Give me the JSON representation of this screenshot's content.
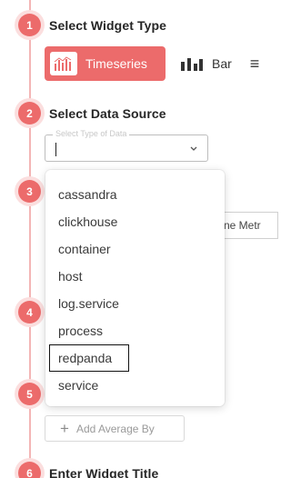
{
  "steps": [
    {
      "number": "1",
      "title": "Select Widget Type"
    },
    {
      "number": "2",
      "title": "Select Data Source"
    },
    {
      "number": "3"
    },
    {
      "number": "4"
    },
    {
      "number": "5"
    },
    {
      "number": "6",
      "title": "Enter Widget Title"
    }
  ],
  "widget_types": {
    "active": {
      "label": "Timeseries",
      "icon": "timeseries-icon"
    },
    "other": {
      "label": "Bar",
      "icon": "bar-chart-icon"
    }
  },
  "data_source": {
    "legend": "Select Type of Data",
    "value": "",
    "options": [
      "cassandra",
      "clickhouse",
      "container",
      "host",
      "log.service",
      "process",
      "redpanda",
      "service"
    ],
    "highlighted": "redpanda"
  },
  "behind_text": "ne Metr",
  "add_average_by": "Add Average By",
  "colors": {
    "accent": "#ec6b6b",
    "rail": "#f3b5b5"
  }
}
